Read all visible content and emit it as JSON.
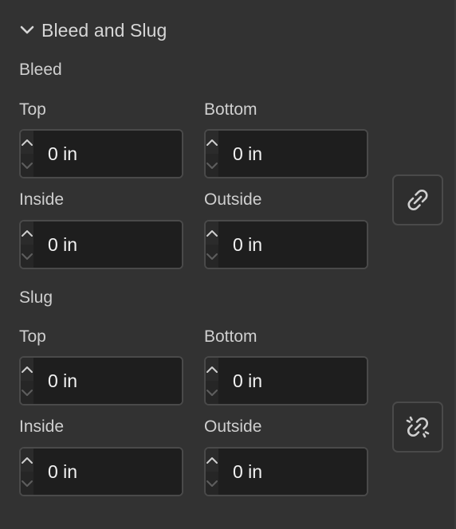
{
  "section": {
    "title": "Bleed and Slug",
    "expanded": true
  },
  "bleed": {
    "label": "Bleed",
    "top_label": "Top",
    "top_value": "0 in",
    "bottom_label": "Bottom",
    "bottom_value": "0 in",
    "inside_label": "Inside",
    "inside_value": "0 in",
    "outside_label": "Outside",
    "outside_value": "0 in",
    "link_icon": "link-icon",
    "linked": true
  },
  "slug": {
    "label": "Slug",
    "top_label": "Top",
    "top_value": "0 in",
    "bottom_label": "Bottom",
    "bottom_value": "0 in",
    "inside_label": "Inside",
    "inside_value": "0 in",
    "outside_label": "Outside",
    "outside_value": "0 in",
    "link_icon": "unlink-icon",
    "linked": false
  },
  "colors": {
    "panel_bg": "#323232",
    "field_bg": "#1e1e1e",
    "border": "#4a4a4a",
    "text": "#d8d8d8"
  }
}
